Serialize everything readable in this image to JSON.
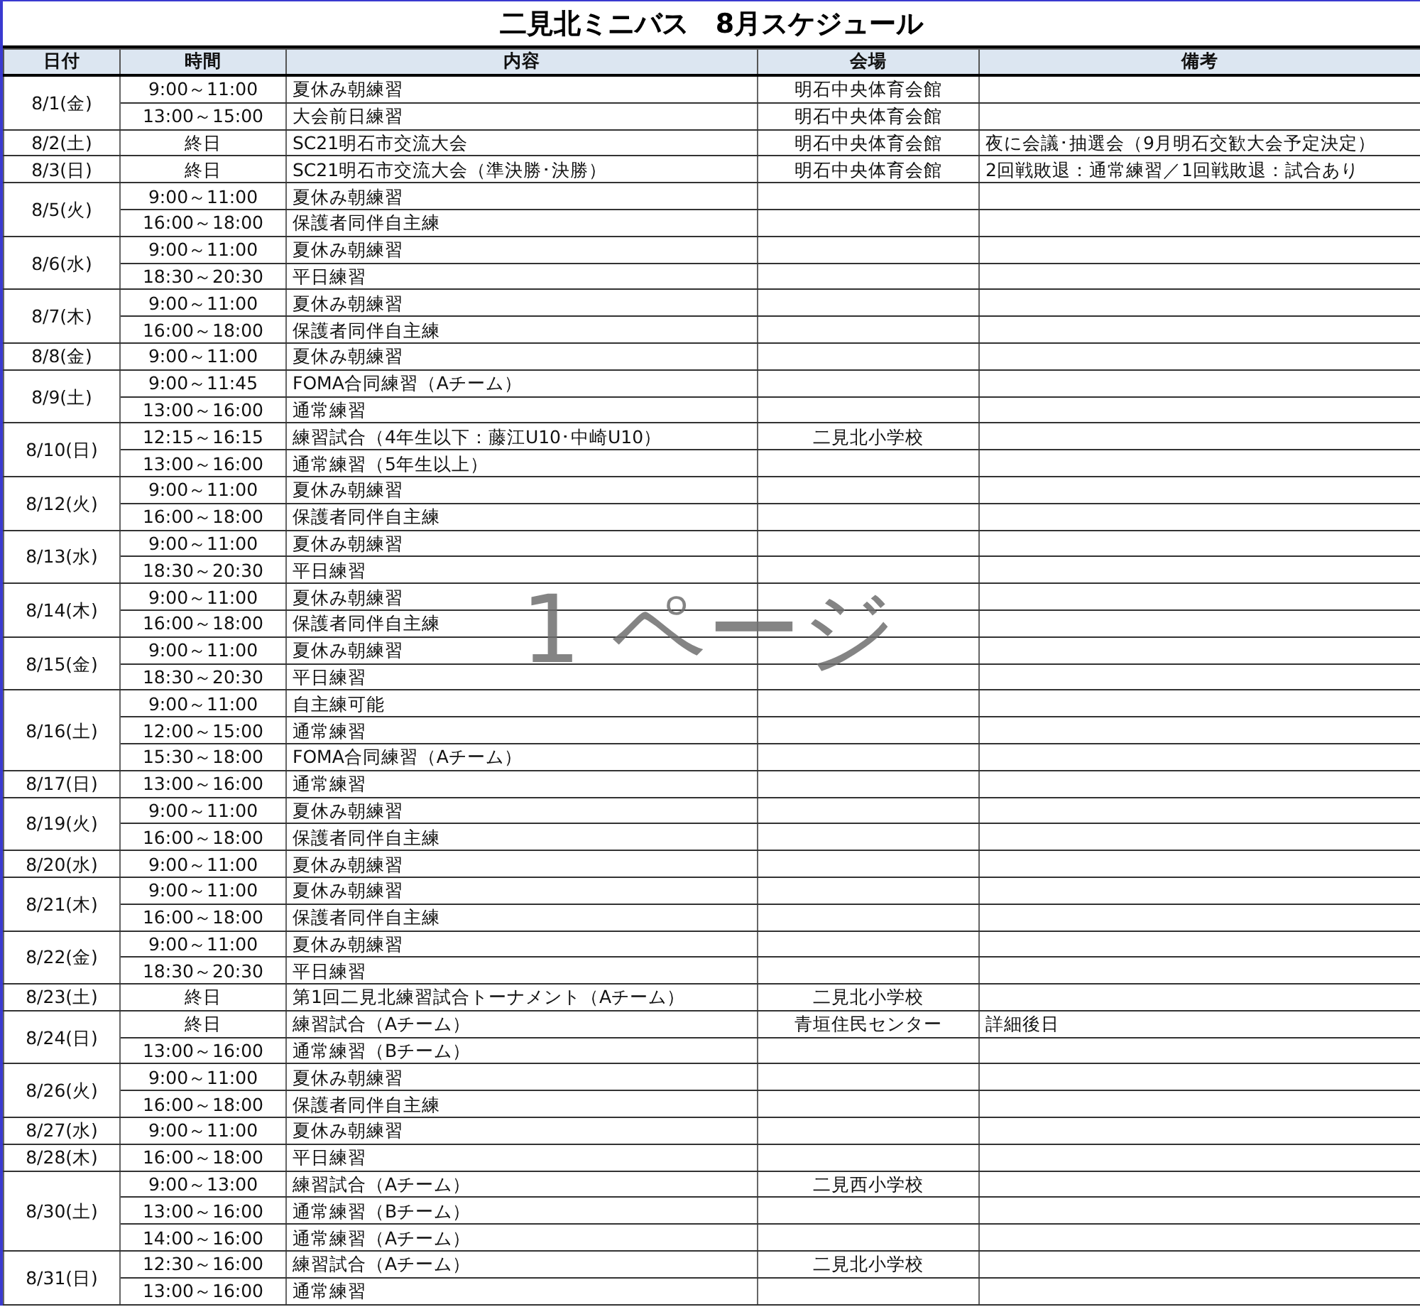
{
  "title": "二見北ミニバス　8月スケジュール",
  "columns": [
    "日付",
    "時間",
    "内容",
    "会場",
    "備考"
  ],
  "page_label": "1 ページ",
  "days": [
    {
      "date": "8/1(金)",
      "slots": [
        {
          "time": "9:00～11:00",
          "content": "夏休み朝練習",
          "venue": "明石中央体育会館"
        },
        {
          "time": "13:00～15:00",
          "content": "大会前日練習",
          "venue": "明石中央体育会館"
        }
      ]
    },
    {
      "date": "8/2(土)",
      "slots": [
        {
          "time": "終日",
          "content": "SC21明石市交流大会",
          "venue": "明石中央体育会館",
          "note": "夜に会議･抽選会（9月明石交歓大会予定決定）"
        }
      ]
    },
    {
      "date": "8/3(日)",
      "slots": [
        {
          "time": "終日",
          "content": "SC21明石市交流大会（準決勝･決勝）",
          "venue": "明石中央体育会館",
          "note": "2回戦敗退：通常練習／1回戦敗退：試合あり"
        }
      ]
    },
    {
      "date": "8/5(火)",
      "slots": [
        {
          "time": "9:00～11:00",
          "content": "夏休み朝練習"
        },
        {
          "time": "16:00～18:00",
          "content": "保護者同伴自主練"
        }
      ]
    },
    {
      "date": "8/6(水)",
      "slots": [
        {
          "time": "9:00～11:00",
          "content": "夏休み朝練習"
        },
        {
          "time": "18:30～20:30",
          "content": "平日練習"
        }
      ]
    },
    {
      "date": "8/7(木)",
      "slots": [
        {
          "time": "9:00～11:00",
          "content": "夏休み朝練習"
        },
        {
          "time": "16:00～18:00",
          "content": "保護者同伴自主練"
        }
      ]
    },
    {
      "date": "8/8(金)",
      "slots": [
        {
          "time": "9:00～11:00",
          "content": "夏休み朝練習"
        }
      ]
    },
    {
      "date": "8/9(土)",
      "slots": [
        {
          "time": "9:00～11:45",
          "content": "FOMA合同練習（Aチーム）"
        },
        {
          "time": "13:00～16:00",
          "content": "通常練習"
        }
      ]
    },
    {
      "date": "8/10(日)",
      "slots": [
        {
          "time": "12:15～16:15",
          "content": "練習試合（4年生以下：藤江U10･中崎U10）",
          "venue": "二見北小学校"
        },
        {
          "time": "13:00～16:00",
          "content": "通常練習（5年生以上）"
        }
      ]
    },
    {
      "date": "8/12(火)",
      "slots": [
        {
          "time": "9:00～11:00",
          "content": "夏休み朝練習"
        },
        {
          "time": "16:00～18:00",
          "content": "保護者同伴自主練"
        }
      ]
    },
    {
      "date": "8/13(水)",
      "slots": [
        {
          "time": "9:00～11:00",
          "content": "夏休み朝練習"
        },
        {
          "time": "18:30～20:30",
          "content": "平日練習"
        }
      ]
    },
    {
      "date": "8/14(木)",
      "slots": [
        {
          "time": "9:00～11:00",
          "content": "夏休み朝練習"
        },
        {
          "time": "16:00～18:00",
          "content": "保護者同伴自主練"
        }
      ]
    },
    {
      "date": "8/15(金)",
      "slots": [
        {
          "time": "9:00～11:00",
          "content": "夏休み朝練習"
        },
        {
          "time": "18:30～20:30",
          "content": "平日練習"
        }
      ]
    },
    {
      "date": "8/16(土)",
      "slots": [
        {
          "time": "9:00～11:00",
          "content": "自主練可能"
        },
        {
          "time": "12:00～15:00",
          "content": "通常練習"
        },
        {
          "time": "15:30～18:00",
          "content": "FOMA合同練習（Aチーム）"
        }
      ]
    },
    {
      "date": "8/17(日)",
      "slots": [
        {
          "time": "13:00～16:00",
          "content": "通常練習"
        }
      ]
    },
    {
      "date": "8/19(火)",
      "slots": [
        {
          "time": "9:00～11:00",
          "content": "夏休み朝練習"
        },
        {
          "time": "16:00～18:00",
          "content": "保護者同伴自主練"
        }
      ]
    },
    {
      "date": "8/20(水)",
      "slots": [
        {
          "time": "9:00～11:00",
          "content": "夏休み朝練習"
        }
      ]
    },
    {
      "date": "8/21(木)",
      "slots": [
        {
          "time": "9:00～11:00",
          "content": "夏休み朝練習"
        },
        {
          "time": "16:00～18:00",
          "content": "保護者同伴自主練"
        }
      ]
    },
    {
      "date": "8/22(金)",
      "slots": [
        {
          "time": "9:00～11:00",
          "content": "夏休み朝練習"
        },
        {
          "time": "18:30～20:30",
          "content": "平日練習"
        }
      ]
    },
    {
      "date": "8/23(土)",
      "slots": [
        {
          "time": "終日",
          "content": "第1回二見北練習試合トーナメント（Aチーム）",
          "venue": "二見北小学校"
        }
      ]
    },
    {
      "date": "8/24(日)",
      "slots": [
        {
          "time": "終日",
          "content": "練習試合（Aチーム）",
          "venue": "青垣住民センター",
          "note": "詳細後日"
        },
        {
          "time": "13:00～16:00",
          "content": "通常練習（Bチーム）"
        }
      ]
    },
    {
      "date": "8/26(火)",
      "slots": [
        {
          "time": "9:00～11:00",
          "content": "夏休み朝練習"
        },
        {
          "time": "16:00～18:00",
          "content": "保護者同伴自主練"
        }
      ]
    },
    {
      "date": "8/27(水)",
      "slots": [
        {
          "time": "9:00～11:00",
          "content": "夏休み朝練習"
        }
      ]
    },
    {
      "date": "8/28(木)",
      "slots": [
        {
          "time": "16:00～18:00",
          "content": "平日練習"
        }
      ]
    },
    {
      "date": "8/30(土)",
      "slots": [
        {
          "time": "9:00～13:00",
          "content": "練習試合（Aチーム）",
          "venue": "二見西小学校"
        },
        {
          "time": "13:00～16:00",
          "content": "通常練習（Bチーム）"
        },
        {
          "time": "14:00～16:00",
          "content": "通常練習（Aチーム）"
        }
      ]
    },
    {
      "date": "8/31(日)",
      "slots": [
        {
          "time": "12:30～16:00",
          "content": "練習試合（Aチーム）",
          "venue": "二見北小学校"
        },
        {
          "time": "13:00～16:00",
          "content": "通常練習"
        }
      ]
    }
  ]
}
